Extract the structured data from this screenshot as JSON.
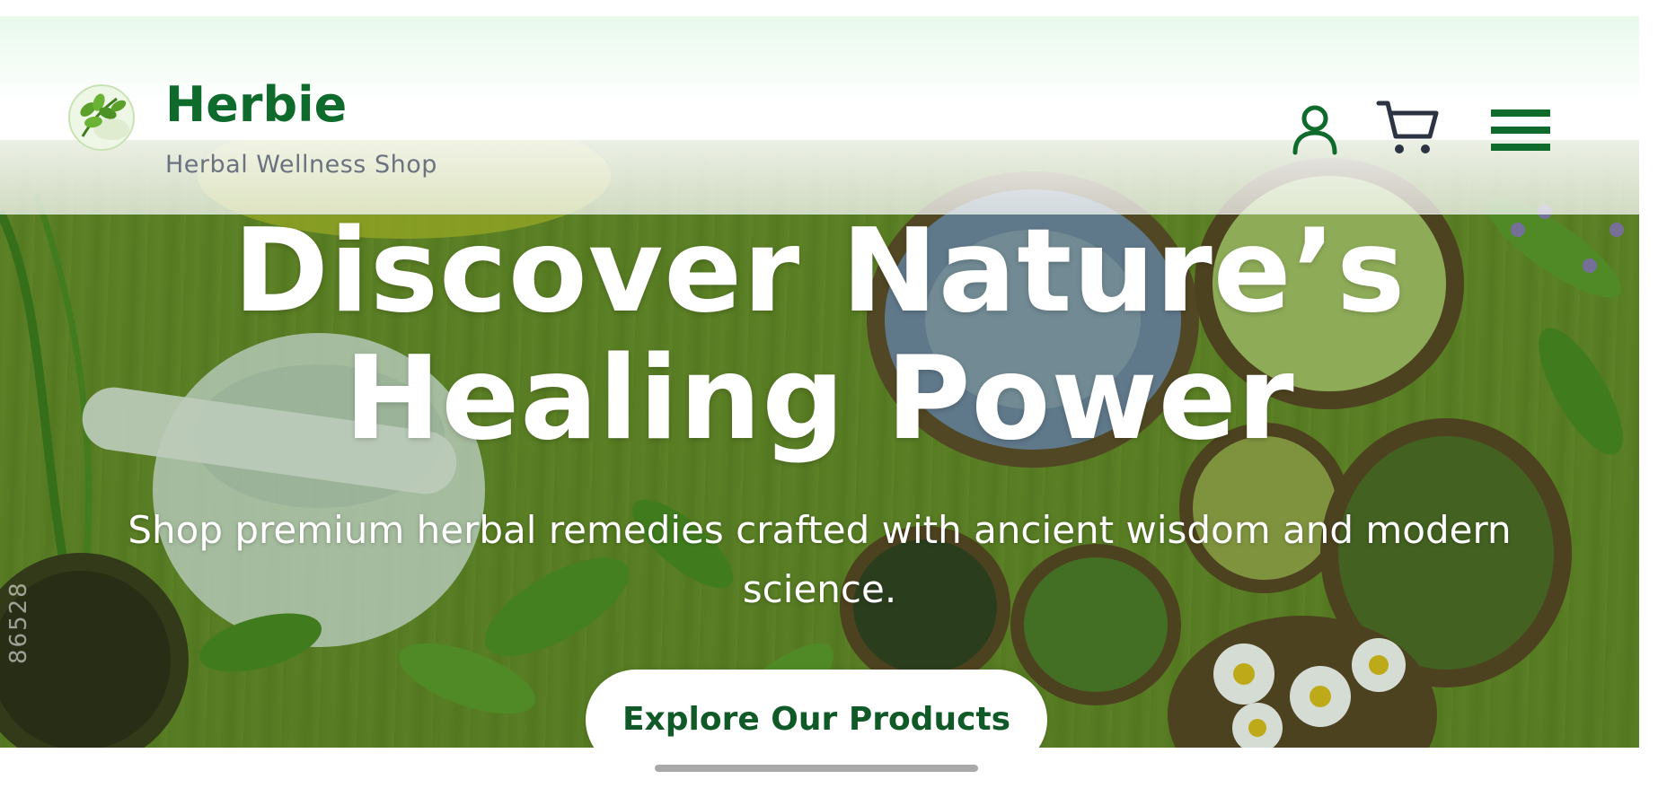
{
  "brand": {
    "name": "Herbie",
    "tagline": "Herbal Wellness Shop",
    "logo_icon": "herb-leaves-logo"
  },
  "header": {
    "icons": [
      "user-icon",
      "cart-icon",
      "hamburger-menu-icon"
    ]
  },
  "hero": {
    "title_line1": "Discover Nature’s",
    "title_line2": "Healing Power",
    "subtitle_line1": "Shop premium herbal remedies crafted with ancient wisdom and modern",
    "subtitle_line2": "science.",
    "cta_label": "Explore Our Products",
    "watermark": "86528"
  },
  "colors": {
    "brand_green": "#0f6b2c",
    "tagline_gray": "#6b7280",
    "cta_text": "#0f5a27"
  }
}
